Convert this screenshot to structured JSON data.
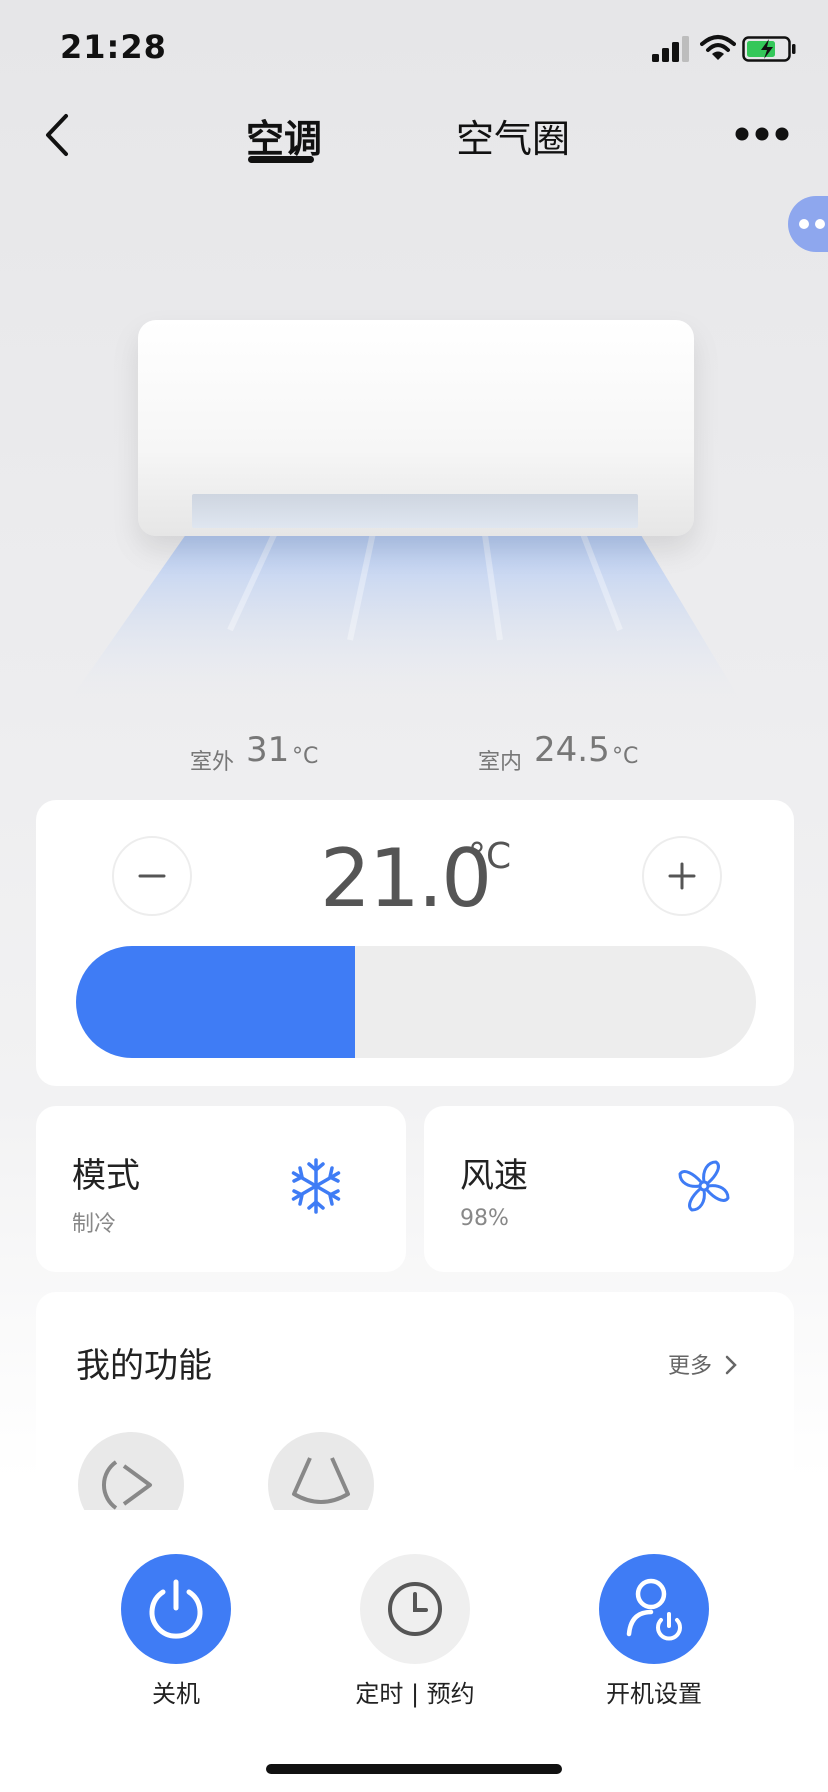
{
  "status_bar": {
    "time": "21:28"
  },
  "nav": {
    "tabs": [
      {
        "label": "空调",
        "active": true
      },
      {
        "label": "空气圈",
        "active": false
      }
    ]
  },
  "temperatures": {
    "outdoor": {
      "label": "室外",
      "value": "31",
      "unit": "°C"
    },
    "indoor": {
      "label": "室内",
      "value": "24.5",
      "unit": "°C"
    }
  },
  "setpoint": {
    "value": "21.0",
    "unit": "°C",
    "slider_fraction": 0.41,
    "minus": "−",
    "plus": "+"
  },
  "mode_card": {
    "title": "模式",
    "value": "制冷",
    "icon": "snowflake-icon"
  },
  "wind_card": {
    "title": "风速",
    "value": "98%",
    "icon": "fan-icon"
  },
  "functions": {
    "title": "我的功能",
    "more_label": "更多"
  },
  "bottom_actions": [
    {
      "label": "关机",
      "icon": "power-icon"
    },
    {
      "label": "定时 | 预约",
      "icon": "clock-icon"
    },
    {
      "label": "开机设置",
      "icon": "user-power-icon"
    }
  ],
  "colors": {
    "accent": "#3f7cf5",
    "background": "#ebebed",
    "card": "#ffffff"
  }
}
